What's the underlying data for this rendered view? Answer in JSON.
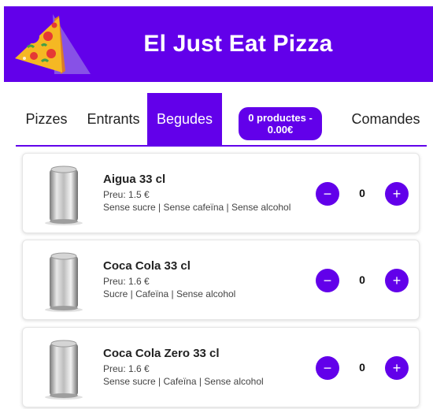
{
  "header": {
    "title": "El Just Eat Pizza",
    "logo_icon": "pizza-slice-logo-icon",
    "brand_color": "#6200ea"
  },
  "nav": {
    "tabs": [
      {
        "label": "Pizzes",
        "active": false
      },
      {
        "label": "Entrants",
        "active": false
      },
      {
        "label": "Begudes",
        "active": true
      },
      {
        "label": "Comandes",
        "active": false
      }
    ],
    "cart": {
      "label": "0 productes - 0.00€"
    }
  },
  "products": [
    {
      "name": "Aigua 33 cl",
      "price": "Preu: 1.5 €",
      "tags": "Sense sucre | Sense cafeïna | Sense alcohol",
      "quantity": "0",
      "image_icon": "drink-can-icon"
    },
    {
      "name": "Coca Cola 33 cl",
      "price": "Preu: 1.6 €",
      "tags": "Sucre | Cafeïna | Sense alcohol",
      "quantity": "0",
      "image_icon": "drink-can-icon"
    },
    {
      "name": "Coca Cola Zero 33 cl",
      "price": "Preu: 1.6 €",
      "tags": "Sense sucre | Cafeïna | Sense alcohol",
      "quantity": "0",
      "image_icon": "drink-can-icon"
    }
  ],
  "controls": {
    "minus_symbol": "−",
    "plus_symbol": "+"
  }
}
